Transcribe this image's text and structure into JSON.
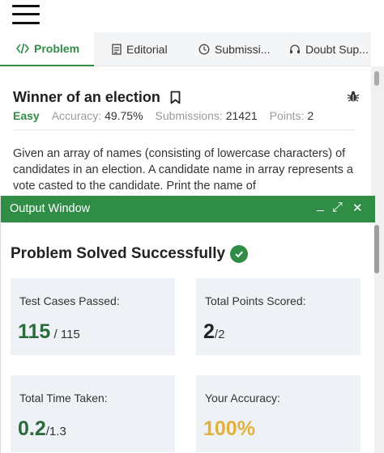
{
  "header": {
    "menu_icon": "hamburger-icon"
  },
  "tabs": [
    {
      "label": "Problem",
      "icon": "code-icon",
      "active": true
    },
    {
      "label": "Editorial",
      "icon": "document-icon",
      "active": false
    },
    {
      "label": "Submissi...",
      "icon": "clock-icon",
      "active": false
    },
    {
      "label": "Doubt Sup...",
      "icon": "headset-icon",
      "active": false
    }
  ],
  "problem": {
    "title": "Winner of an election",
    "difficulty": "Easy",
    "accuracy_label": "Accuracy:",
    "accuracy_value": "49.75%",
    "submissions_label": "Submissions:",
    "submissions_value": "21421",
    "points_label": "Points:",
    "points_value": "2",
    "description": "Given an array of names (consisting of lowercase characters) of candidates in an election. A candidate name in array represents a vote casted to the candidate. Print the name of"
  },
  "output_window": {
    "title": "Output Window",
    "minimize_symbol": "_",
    "expand_symbol": "⤢",
    "close_symbol": "✕",
    "status": "Problem Solved Successfully",
    "cards": [
      {
        "label": "Test Cases Passed:",
        "value": "115",
        "total": " / 115"
      },
      {
        "label": "Total Points Scored:",
        "value": "2",
        "total": "/2"
      },
      {
        "label": "Total Time Taken:",
        "value": "0.2",
        "total": "/1.3"
      },
      {
        "label": "Your Accuracy:",
        "value": "100%",
        "total": ""
      }
    ]
  },
  "colors": {
    "brand_green": "#2f8d46",
    "accuracy_gold": "#e0b23c",
    "card_bg": "#eef1f6"
  }
}
